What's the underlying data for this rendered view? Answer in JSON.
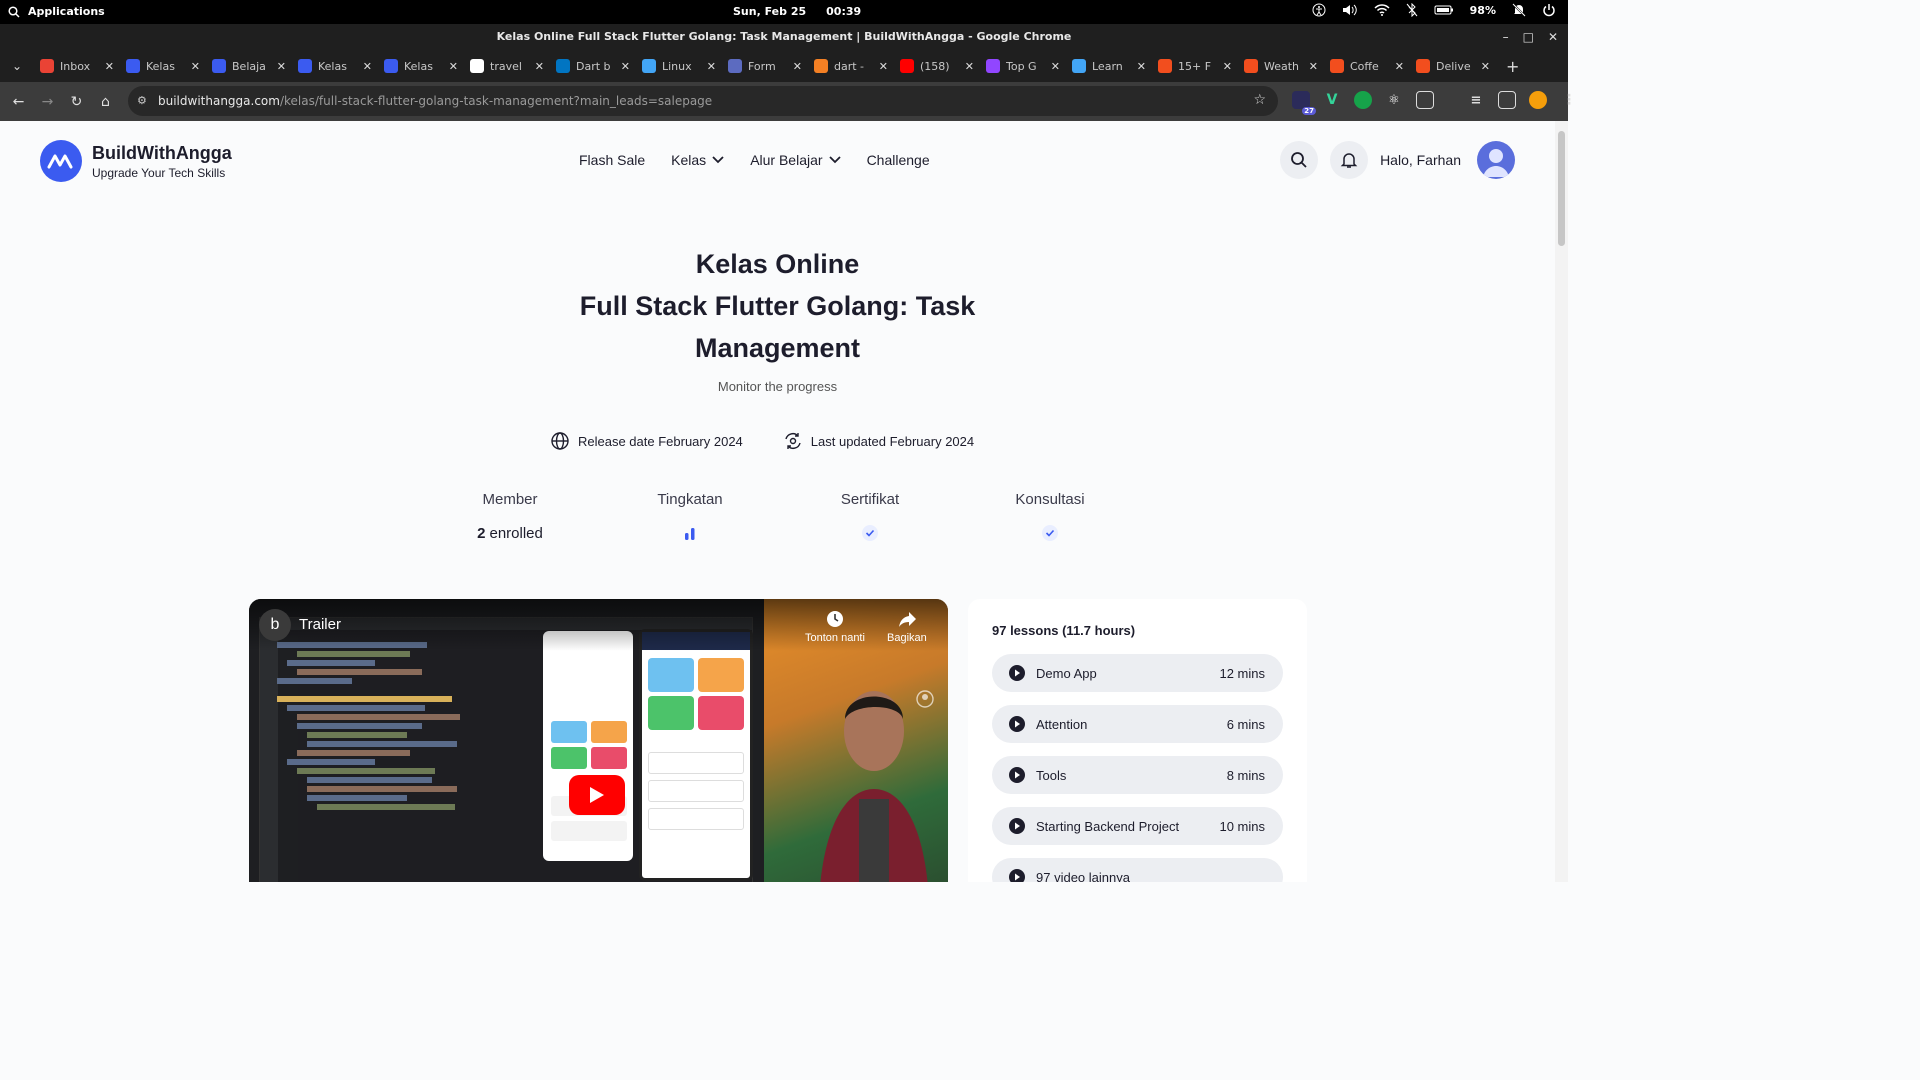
{
  "system": {
    "applications_label": "Applications",
    "date": "Sun, Feb 25",
    "time": "00:39",
    "battery": "98%"
  },
  "window": {
    "title": "Kelas Online Full Stack Flutter Golang: Task Management | BuildWithAngga - Google Chrome"
  },
  "tabs": [
    {
      "label": "Inbox",
      "color": "#ea4335",
      "icon": "gmail-icon"
    },
    {
      "label": "Kelas",
      "color": "#3b5bf0",
      "icon": "bwa-icon"
    },
    {
      "label": "Belaja",
      "color": "#3b5bf0",
      "icon": "bwa-icon"
    },
    {
      "label": "Kelas",
      "color": "#3b5bf0",
      "icon": "bwa-icon"
    },
    {
      "label": "Kelas",
      "color": "#3b5bf0",
      "icon": "bwa-icon"
    },
    {
      "label": "travel",
      "color": "#ffffff",
      "icon": "github-icon"
    },
    {
      "label": "Dart b",
      "color": "#0175c2",
      "icon": "dart-icon"
    },
    {
      "label": "Linux",
      "color": "#42a5f5",
      "icon": "flutter-icon"
    },
    {
      "label": "Form",
      "color": "#5c6bc0",
      "icon": "form-icon"
    },
    {
      "label": "dart -",
      "color": "#f48024",
      "icon": "stackoverflow-icon"
    },
    {
      "label": "(158)",
      "color": "#ff0000",
      "icon": "youtube-icon"
    },
    {
      "label": "Top G",
      "color": "#9146ff",
      "icon": "twitch-icon"
    },
    {
      "label": "Learn",
      "color": "#42a5f5",
      "icon": "flutter-icon"
    },
    {
      "label": "15+ F",
      "color": "#f24e1e",
      "icon": "figma-icon"
    },
    {
      "label": "Weath",
      "color": "#f24e1e",
      "icon": "figma-icon"
    },
    {
      "label": "Coffe",
      "color": "#f24e1e",
      "icon": "figma-icon"
    },
    {
      "label": "Delive",
      "color": "#f24e1e",
      "icon": "figma-icon"
    }
  ],
  "address": {
    "domain": "buildwithangga.com",
    "path": "/kelas/full-stack-flutter-golang-task-management?main_leads=salepage"
  },
  "extensions": {
    "badge": "27"
  },
  "site": {
    "brand": "BuildWithAngga",
    "tagline": "Upgrade Your Tech Skills",
    "nav": {
      "flash_sale": "Flash Sale",
      "kelas": "Kelas",
      "alur_belajar": "Alur Belajar",
      "challenge": "Challenge"
    },
    "greeting": "Halo, Farhan",
    "accent": "#3b5bf0"
  },
  "hero": {
    "title_line1": "Kelas Online",
    "title_line2": "Full Stack Flutter Golang: Task Management",
    "subtitle": "Monitor the progress"
  },
  "dates": {
    "release": "Release date February 2024",
    "updated": "Last updated February 2024"
  },
  "stats": {
    "member_label": "Member",
    "member_count": "2",
    "member_suffix": "enrolled",
    "level_label": "Tingkatan",
    "certificate_label": "Sertifikat",
    "consultation_label": "Konsultasi"
  },
  "video": {
    "channel_initial": "b",
    "title": "Trailer",
    "watch_later": "Tonton nanti",
    "share": "Bagikan"
  },
  "lessons": {
    "summary": "97 lessons (11.7 hours)",
    "items": [
      {
        "name": "Demo App",
        "duration": "12 mins"
      },
      {
        "name": "Attention",
        "duration": "6 mins"
      },
      {
        "name": "Tools",
        "duration": "8 mins"
      },
      {
        "name": "Starting Backend Project",
        "duration": "10 mins"
      }
    ],
    "more": "97 video lainnya"
  }
}
